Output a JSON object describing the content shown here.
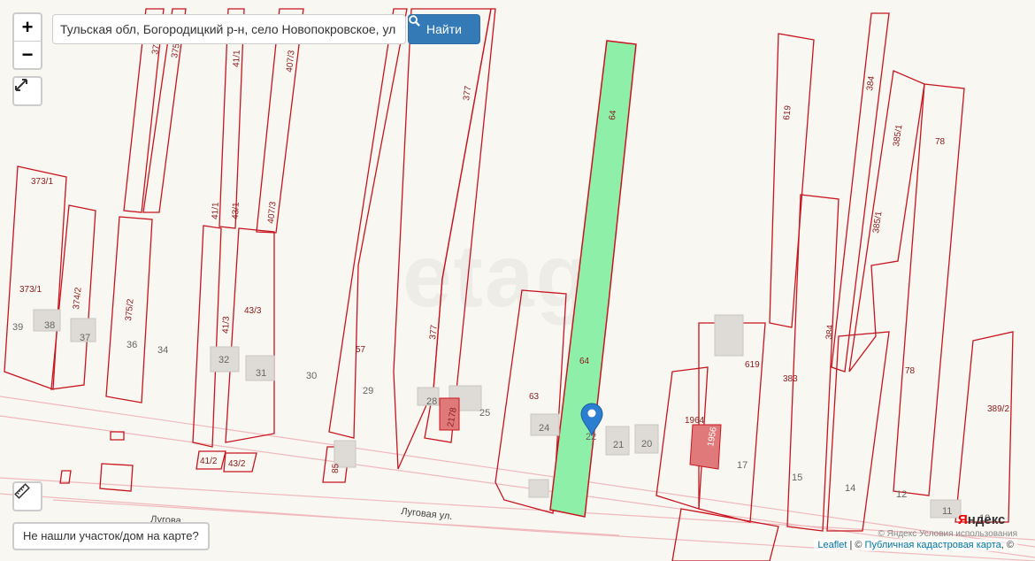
{
  "search": {
    "value": "Тульская обл, Богородицкий р-н, село Новопокровское, ул Луговая",
    "placeholder": "",
    "button_label": "Найти",
    "icon": "search-icon"
  },
  "controls": {
    "zoom_in": "+",
    "zoom_out": "−",
    "fullscreen_icon": "expand-icon",
    "ruler_icon": "ruler-icon",
    "not_found_label": "Не нашли участок/дом на карте?"
  },
  "map": {
    "watermark": "etagi",
    "selected_parcel": "64",
    "parcel_labels": [
      "374",
      "375",
      "41/1",
      "407/3",
      "377",
      "64",
      "619",
      "384",
      "385/1",
      "78",
      "373/1",
      "41/1",
      "43/1",
      "407/3",
      "373/1",
      "374/2",
      "375/2",
      "41/3",
      "43/3",
      "385/1",
      "57",
      "377",
      "64",
      "619",
      "383",
      "384",
      "78",
      "389/2",
      "1964",
      "1956",
      "63",
      "2178",
      "41/2",
      "43/2",
      "85"
    ],
    "house_numbers": [
      "39",
      "38",
      "37",
      "36",
      "34",
      "32",
      "31",
      "30",
      "29",
      "28",
      "25",
      "24",
      "22",
      "21",
      "20",
      "17",
      "15",
      "14",
      "12",
      "11",
      "10"
    ],
    "streets": [
      "Луговая ул.",
      "Лугова"
    ],
    "colors": {
      "parcel_border": "#c8141e",
      "selected_fill": "#8ef0a8",
      "marker": "#2a7fd1",
      "building": "#dedbd6",
      "building_red": "#e07a7a"
    }
  },
  "attribution": {
    "leaflet": "Leaflet",
    "separator": "| ©",
    "cadastral": "Публичная кадастровая карта",
    "tail": ", ©",
    "yandex_terms": "© Яндекс  Условия использования",
    "yandex_logo_y": "Я",
    "yandex_logo_rest": "ндекс"
  }
}
